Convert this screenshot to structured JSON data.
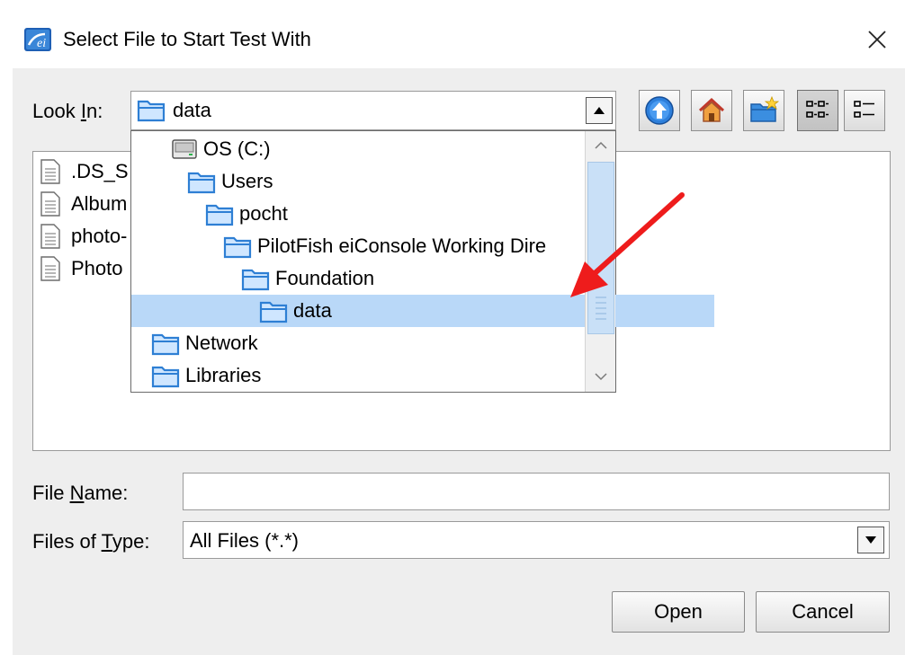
{
  "window": {
    "title": "Select File to Start Test With"
  },
  "look_in": {
    "label_pre": "Look ",
    "label_mnemonic": "I",
    "label_post": "n:",
    "value": "data"
  },
  "toolbar": {
    "up_icon": "up-one-level-icon",
    "home_icon": "home-icon",
    "new_folder_icon": "new-folder-icon",
    "list_view_icon": "list-view-icon",
    "details_view_icon": "details-view-icon"
  },
  "files": [
    {
      "name": ".DS_S"
    },
    {
      "name": "Album"
    },
    {
      "name": "photo-"
    },
    {
      "name": "Photo"
    }
  ],
  "dropdown": {
    "items": [
      {
        "label": "OS (C:)",
        "icon": "drive-icon",
        "level": 1,
        "selected": false
      },
      {
        "label": "Users",
        "icon": "folder-icon",
        "level": 2,
        "selected": false
      },
      {
        "label": "pocht",
        "icon": "folder-icon",
        "level": 3,
        "selected": false
      },
      {
        "label": "PilotFish eiConsole Working Dire",
        "icon": "folder-icon",
        "level": 4,
        "selected": false
      },
      {
        "label": "Foundation",
        "icon": "folder-icon",
        "level": 5,
        "selected": false
      },
      {
        "label": "data",
        "icon": "folder-icon",
        "level": 6,
        "selected": true
      },
      {
        "label": "Network",
        "icon": "folder-icon",
        "level": 0,
        "selected": false
      },
      {
        "label": "Libraries",
        "icon": "folder-icon",
        "level": 0,
        "selected": false
      }
    ]
  },
  "file_name": {
    "label_pre": "File ",
    "label_mnemonic": "N",
    "label_post": "ame:",
    "value": ""
  },
  "files_of_type": {
    "label_pre": "Files of ",
    "label_mnemonic": "T",
    "label_post": "ype:",
    "value": "All Files (*.*)"
  },
  "buttons": {
    "open": "Open",
    "cancel": "Cancel"
  },
  "colors": {
    "selection": "#b9d8f8",
    "arrow": "#ee1c1c",
    "folder": "#2e7fd4"
  }
}
